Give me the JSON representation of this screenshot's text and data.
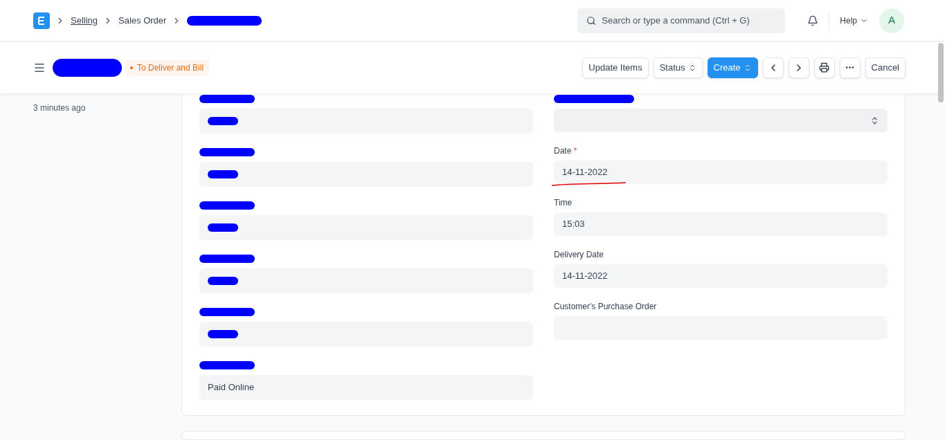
{
  "navbar": {
    "breadcrumbs": [
      {
        "kind": "link",
        "label": "Selling"
      },
      {
        "kind": "text",
        "label": "Sales Order"
      },
      {
        "kind": "redacted"
      }
    ],
    "search": {
      "placeholder": "Search or type a command (Ctrl + G)"
    },
    "help": "Help",
    "avatar": "A"
  },
  "toolbar": {
    "title_redacted": true,
    "status": "To Deliver and Bill",
    "buttons": [
      {
        "kind": "text",
        "label": "Update Items"
      },
      {
        "kind": "select",
        "label": "Status"
      },
      {
        "kind": "primary",
        "label": "Create"
      },
      {
        "kind": "prev"
      },
      {
        "kind": "next"
      },
      {
        "kind": "print"
      },
      {
        "kind": "more"
      },
      {
        "kind": "text",
        "label": "Cancel"
      }
    ]
  },
  "sidebar": {
    "timestamp": "3 minutes ago"
  },
  "left_fields": [
    {
      "label_redacted": true,
      "value_redacted": true
    },
    {
      "label_redacted": true,
      "value_redacted": true
    },
    {
      "label_redacted": true,
      "value_redacted": true
    },
    {
      "label_redacted": true,
      "value_redacted": true
    },
    {
      "label_redacted": true,
      "value_redacted": true
    },
    {
      "label_redacted": true,
      "value_redacted": false,
      "value": "Paid Online"
    }
  ],
  "right_fields": [
    {
      "kind": "select",
      "label_redacted": true
    },
    {
      "kind": "input",
      "label_redacted": false,
      "label": "Date",
      "required_marker": "*",
      "value": "14-11-2022",
      "underlined": true
    },
    {
      "kind": "input",
      "label_redacted": false,
      "label": "Time",
      "value": "15:03",
      "underlined": false
    },
    {
      "kind": "input",
      "label_redacted": false,
      "label": "Delivery Date",
      "value": "14-11-2022",
      "underlined": false
    },
    {
      "kind": "input",
      "label_redacted": false,
      "label": "Customer's Purchase Order",
      "underlined": false
    }
  ]
}
